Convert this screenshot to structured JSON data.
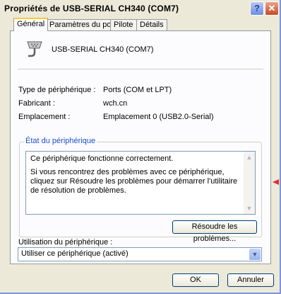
{
  "window": {
    "title": "Propriétés de USB-SERIAL CH340 (COM7)",
    "help_icon": "?",
    "close_icon": "✕"
  },
  "tabs": [
    {
      "label": "Général",
      "active": true
    },
    {
      "label": "Paramètres du port",
      "active": false
    },
    {
      "label": "Pilote",
      "active": false
    },
    {
      "label": "Détails",
      "active": false
    }
  ],
  "device": {
    "icon": "serial-port-icon",
    "name": "USB-SERIAL CH340 (COM7)"
  },
  "properties": [
    {
      "label": "Type de périphérique :",
      "value": "Ports (COM et LPT)"
    },
    {
      "label": "Fabricant :",
      "value": "wch.cn"
    },
    {
      "label": "Emplacement :",
      "value": "Emplacement 0 (USB2.0-Serial)"
    }
  ],
  "status": {
    "legend": "État du périphérique",
    "line1": "Ce périphérique fonctionne correctement.",
    "line2": "Si vous rencontrez des problèmes avec ce périphérique, cliquez sur Résoudre les problèmes pour démarrer l'utilitaire de résolution de problèmes.",
    "troubleshoot_label": "Résoudre les problèmes..."
  },
  "usage": {
    "label": "Utilisation du périphérique :",
    "selected": "Utiliser ce périphérique (activé)"
  },
  "footer": {
    "ok_label": "OK",
    "cancel_label": "Annuler"
  },
  "colors": {
    "active_tab_accent": "#ffc83c",
    "legend_text": "#1a50c8",
    "annotation_arrow": "#e0302a"
  }
}
